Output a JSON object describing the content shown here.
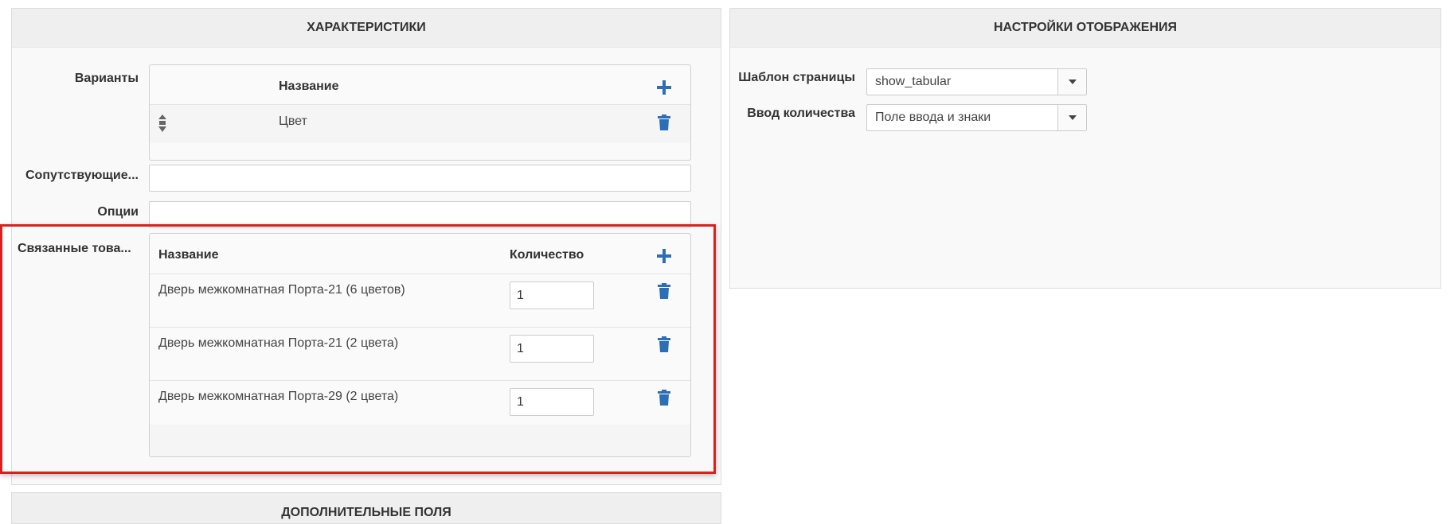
{
  "left_panel": {
    "title": "ХАРАКТЕРИСТИКИ",
    "variants": {
      "label": "Варианты",
      "header_name": "Название",
      "rows": [
        {
          "name": "Цвет"
        }
      ]
    },
    "companions": {
      "label": "Сопутствующие..."
    },
    "options": {
      "label": "Опции"
    },
    "related": {
      "label": "Связанные това...",
      "header_name": "Название",
      "header_qty": "Количество",
      "rows": [
        {
          "name": "Дверь межкомнатная Порта-21 (6 цветов)",
          "qty": "1"
        },
        {
          "name": "Дверь межкомнатная Порта-21 (2 цвета)",
          "qty": "1"
        },
        {
          "name": "Дверь межкомнатная Порта-29 (2 цвета)",
          "qty": "1"
        }
      ]
    }
  },
  "right_panel": {
    "title": "НАСТРОЙКИ ОТОБРАЖЕНИЯ",
    "page_template": {
      "label": "Шаблон страницы",
      "value": "show_tabular"
    },
    "qty_input": {
      "label": "Ввод количества",
      "value": "Поле ввода и знаки"
    }
  },
  "bottom_panel": {
    "title": "ДОПОЛНИТЕЛЬНЫЕ ПОЛЯ"
  },
  "colors": {
    "accent": "#2c6fb5",
    "highlight": "#d9201f",
    "header_bg": "#efefef"
  },
  "icons": {
    "add": "plus-icon",
    "delete": "trash-icon",
    "sort": "drag-sort-icon",
    "dropdown": "caret-down-icon"
  }
}
